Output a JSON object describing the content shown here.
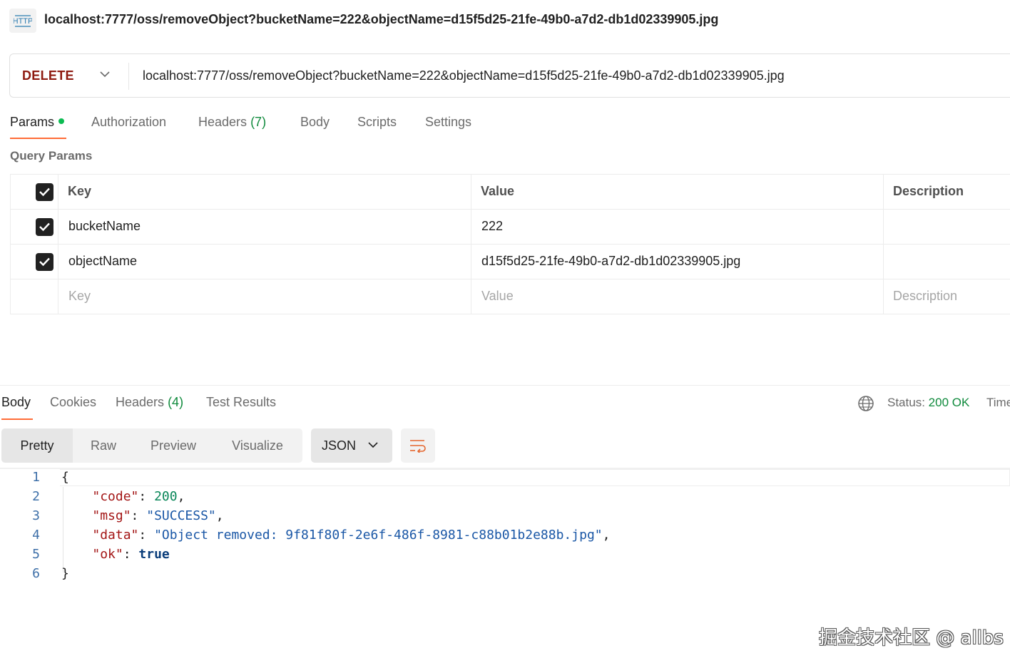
{
  "title_bar": {
    "icon": "http-icon",
    "icon_text": "HTTP",
    "title": "localhost:7777/oss/removeObject?bucketName=222&objectName=d15f5d25-21fe-49b0-a7d2-db1d02339905.jpg"
  },
  "request": {
    "method": "DELETE",
    "url": "localhost:7777/oss/removeObject?bucketName=222&objectName=d15f5d25-21fe-49b0-a7d2-db1d02339905.jpg"
  },
  "request_tabs": [
    {
      "label": "Params",
      "active": true,
      "indicator": "green-dot"
    },
    {
      "label": "Authorization"
    },
    {
      "label": "Headers",
      "count": "(7)"
    },
    {
      "label": "Body"
    },
    {
      "label": "Scripts"
    },
    {
      "label": "Settings"
    }
  ],
  "query_params": {
    "title": "Query Params",
    "columns": [
      "Key",
      "Value",
      "Description"
    ],
    "rows": [
      {
        "checked": true,
        "key": "bucketName",
        "value": "222",
        "description": ""
      },
      {
        "checked": true,
        "key": "objectName",
        "value": "d15f5d25-21fe-49b0-a7d2-db1d02339905.jpg",
        "description": ""
      }
    ],
    "placeholders": {
      "key": "Key",
      "value": "Value",
      "description": "Description"
    }
  },
  "response_tabs": [
    {
      "label": "Body",
      "active": true
    },
    {
      "label": "Cookies"
    },
    {
      "label": "Headers",
      "count": "(4)"
    },
    {
      "label": "Test Results"
    }
  ],
  "response_status": {
    "icon": "globe-icon",
    "status_label": "Status:",
    "status_value": "200 OK",
    "time_label": "Time"
  },
  "view_modes": [
    "Pretty",
    "Raw",
    "Preview",
    "Visualize"
  ],
  "active_view_mode": "Pretty",
  "format_select": "JSON",
  "wrap_icon": "wrap-lines-icon",
  "code_lines": [
    {
      "no": "1",
      "text": "{"
    },
    {
      "no": "2",
      "key": "\"code\"",
      "value": "200",
      "value_type": "number",
      "trail": ","
    },
    {
      "no": "3",
      "key": "\"msg\"",
      "value": "\"SUCCESS\"",
      "value_type": "string",
      "trail": ","
    },
    {
      "no": "4",
      "key": "\"data\"",
      "value": "\"Object removed: 9f81f80f-2e6f-486f-8981-c88b01b2e88b.jpg\"",
      "value_type": "string",
      "trail": ","
    },
    {
      "no": "5",
      "key": "\"ok\"",
      "value": "true",
      "value_type": "bool",
      "trail": ""
    },
    {
      "no": "6",
      "text": "}"
    }
  ],
  "watermark": "掘金技术社区 @ allbs",
  "colors": {
    "method": "#8e1a10",
    "accent": "#ff6c37",
    "status_ok": "#0f8a3c",
    "dot": "#0cbb52"
  }
}
